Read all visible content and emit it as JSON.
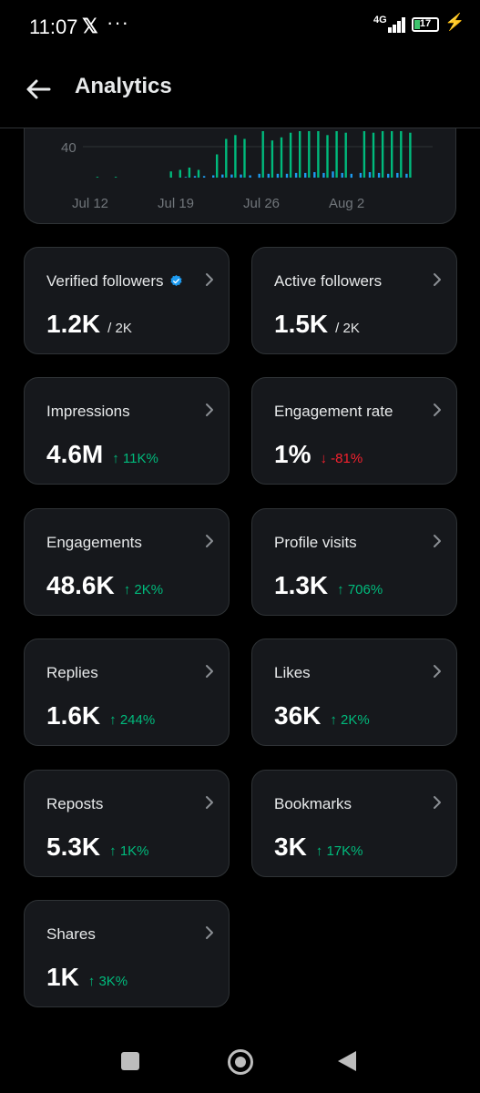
{
  "status_bar": {
    "time": "11:07",
    "x_logo": "𝕏",
    "more": "···",
    "network": "4G",
    "battery": "17"
  },
  "header": {
    "title": "Analytics"
  },
  "chart_data": {
    "type": "bar",
    "x_tick_labels": [
      "Jul 12",
      "Jul 19",
      "Jul 26",
      "Aug 2"
    ],
    "y_tick_labels": [
      "40"
    ],
    "series": [
      {
        "color": "#00ba7c",
        "values": [
          0,
          1,
          0,
          1,
          0,
          0,
          0,
          0,
          0,
          8,
          10,
          13,
          10,
          0,
          30,
          50,
          55,
          50,
          0,
          60,
          48,
          52,
          58,
          60,
          60,
          60,
          55,
          60,
          58,
          0,
          60,
          58,
          60,
          60,
          60,
          58,
          0,
          0
        ]
      },
      {
        "color": "#1d9bf0",
        "values": [
          0,
          0,
          0,
          0,
          0,
          0,
          0,
          0,
          0,
          0,
          0,
          1,
          2,
          2,
          3,
          4,
          4,
          4,
          3,
          5,
          5,
          5,
          5,
          6,
          6,
          7,
          6,
          8,
          6,
          5,
          6,
          7,
          6,
          5,
          6,
          5,
          0,
          0
        ]
      }
    ]
  },
  "cards": [
    {
      "label": "Verified followers",
      "value": "1.2K",
      "sub": "/ 2K",
      "verified": true
    },
    {
      "label": "Active followers",
      "value": "1.5K",
      "sub": "/ 2K"
    },
    {
      "label": "Impressions",
      "value": "4.6M",
      "delta": "↑ 11K%",
      "trend": "up"
    },
    {
      "label": "Engagement rate",
      "value": "1%",
      "delta": "↓ -81%",
      "trend": "down"
    },
    {
      "label": "Engagements",
      "value": "48.6K",
      "delta": "↑ 2K%",
      "trend": "up"
    },
    {
      "label": "Profile visits",
      "value": "1.3K",
      "delta": "↑ 706%",
      "trend": "up"
    },
    {
      "label": "Replies",
      "value": "1.6K",
      "delta": "↑ 244%",
      "trend": "up"
    },
    {
      "label": "Likes",
      "value": "36K",
      "delta": "↑ 2K%",
      "trend": "up"
    },
    {
      "label": "Reposts",
      "value": "5.3K",
      "delta": "↑ 1K%",
      "trend": "up"
    },
    {
      "label": "Bookmarks",
      "value": "3K",
      "delta": "↑ 17K%",
      "trend": "up"
    },
    {
      "label": "Shares",
      "value": "1K",
      "delta": "↑ 3K%",
      "trend": "up"
    }
  ],
  "colors": {
    "up": "#00ba7c",
    "down": "#f4212e",
    "verified": "#1d9bf0"
  },
  "nav": {
    "icons": [
      "recent-apps-icon",
      "home-icon",
      "back-nav-icon"
    ]
  }
}
